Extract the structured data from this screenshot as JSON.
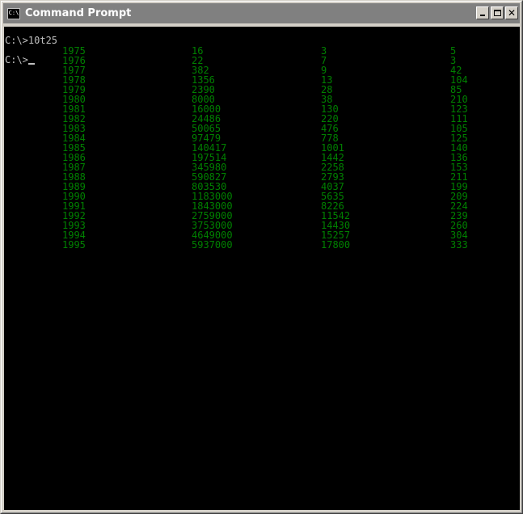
{
  "window": {
    "title": "Command Prompt",
    "icon_text": "C:\\",
    "text_color": "#c0c0c0",
    "data_color": "#008000",
    "background": "#000000"
  },
  "console": {
    "command_line": "C:\\>10t25",
    "prompt_line": "C:\\>",
    "rows": [
      [
        "1975",
        "16",
        "3",
        "5"
      ],
      [
        "1976",
        "22",
        "7",
        "3"
      ],
      [
        "1977",
        "382",
        "9",
        "42"
      ],
      [
        "1978",
        "1356",
        "13",
        "104"
      ],
      [
        "1979",
        "2390",
        "28",
        "85"
      ],
      [
        "1980",
        "8000",
        "38",
        "210"
      ],
      [
        "1981",
        "16000",
        "130",
        "123"
      ],
      [
        "1982",
        "24486",
        "220",
        "111"
      ],
      [
        "1983",
        "50065",
        "476",
        "105"
      ],
      [
        "1984",
        "97479",
        "778",
        "125"
      ],
      [
        "1985",
        "140417",
        "1001",
        "140"
      ],
      [
        "1986",
        "197514",
        "1442",
        "136"
      ],
      [
        "1987",
        "345980",
        "2258",
        "153"
      ],
      [
        "1988",
        "590827",
        "2793",
        "211"
      ],
      [
        "1989",
        "803530",
        "4037",
        "199"
      ],
      [
        "1990",
        "1183000",
        "5635",
        "209"
      ],
      [
        "1991",
        "1843000",
        "8226",
        "224"
      ],
      [
        "1992",
        "2759000",
        "11542",
        "239"
      ],
      [
        "1993",
        "3753000",
        "14430",
        "260"
      ],
      [
        "1994",
        "4649000",
        "15257",
        "304"
      ],
      [
        "1995",
        "5937000",
        "17800",
        "333"
      ]
    ]
  }
}
